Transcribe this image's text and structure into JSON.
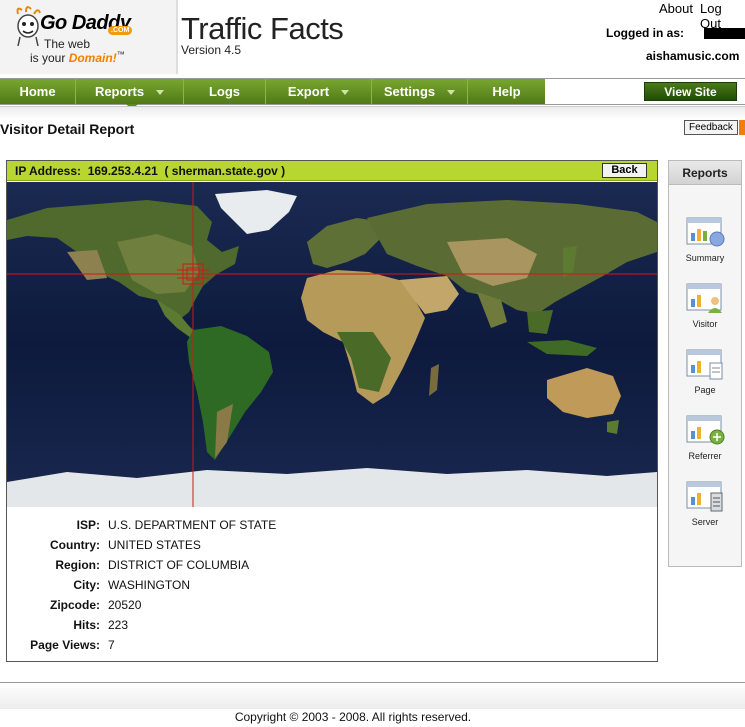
{
  "header": {
    "logo": {
      "brand": "Go Daddy",
      "com": ".COM",
      "tagline_line1": "The web",
      "tagline_line2_prefix": "is your ",
      "tagline_line2_emph": "Domain!",
      "tagline_tm": "™"
    },
    "app_title": "Traffic Facts",
    "version": "Version 4.5",
    "about_link": "About",
    "logout_link": "Log Out",
    "logged_in_label": "Logged in as:",
    "site_name": "aishamusic.com"
  },
  "nav": {
    "items": [
      {
        "label": "Home",
        "dropdown": false
      },
      {
        "label": "Reports",
        "dropdown": true
      },
      {
        "label": "Logs",
        "dropdown": false
      },
      {
        "label": "Export",
        "dropdown": true
      },
      {
        "label": "Settings",
        "dropdown": true
      },
      {
        "label": "Help",
        "dropdown": false
      }
    ],
    "view_site_button": "View Site"
  },
  "page": {
    "title": "Visitor Detail Report",
    "feedback_button": "Feedback"
  },
  "visitor": {
    "ip_label": "IP Address:",
    "ip": "169.253.4.21",
    "host": "( sherman.state.gov )",
    "back_button": "Back",
    "details": [
      {
        "label": "ISP:",
        "value": "U.S. DEPARTMENT OF STATE"
      },
      {
        "label": "Country:",
        "value": "UNITED STATES"
      },
      {
        "label": "Region:",
        "value": "DISTRICT OF COLUMBIA"
      },
      {
        "label": "City:",
        "value": "WASHINGTON"
      },
      {
        "label": "Zipcode:",
        "value": "20520"
      },
      {
        "label": "Hits:",
        "value": "223"
      },
      {
        "label": "Page Views:",
        "value": "7"
      }
    ]
  },
  "sidebar": {
    "title": "Reports",
    "items": [
      {
        "label": "Summary",
        "icon": "summary-report-icon"
      },
      {
        "label": "Visitor",
        "icon": "visitor-report-icon"
      },
      {
        "label": "Page",
        "icon": "page-report-icon"
      },
      {
        "label": "Referrer",
        "icon": "referrer-report-icon"
      },
      {
        "label": "Server",
        "icon": "server-report-icon"
      }
    ]
  },
  "footer": {
    "copyright": "Copyright © 2003 - 2008. All rights reserved."
  },
  "colors": {
    "nav_green": "#5d8a1c",
    "ip_bar": "#b7d630",
    "crosshair": "#d01818",
    "ocean": "#0f1b3a"
  }
}
